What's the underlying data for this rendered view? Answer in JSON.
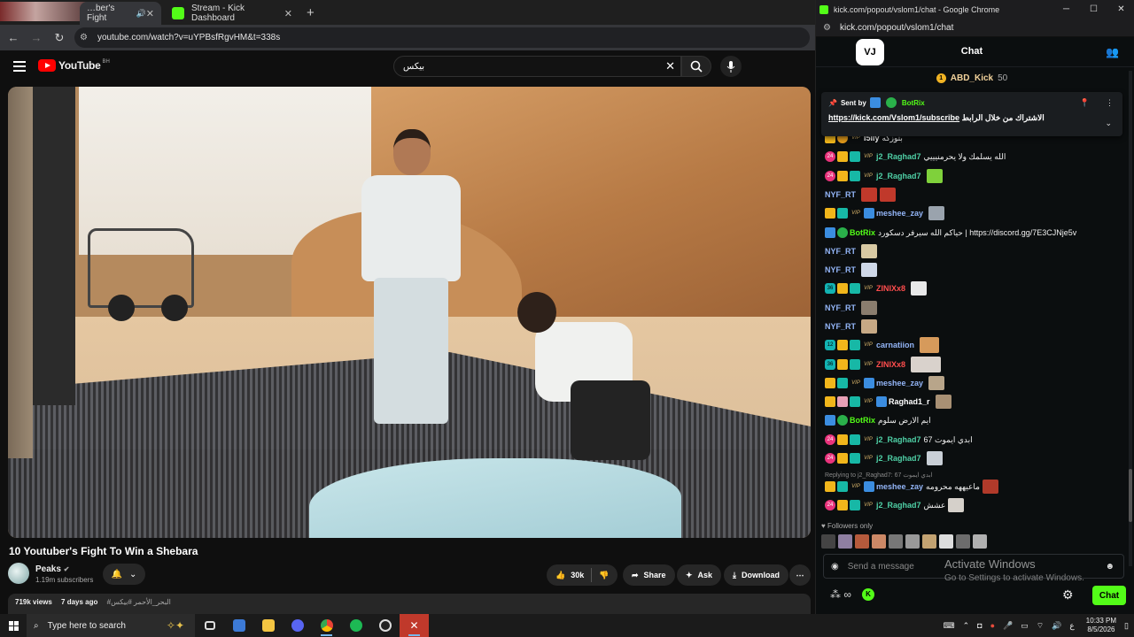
{
  "browser_left": {
    "tabs": [
      {
        "label": "…ber's Fight",
        "active": true
      },
      {
        "label": "Stream - Kick Dashboard",
        "active": false
      }
    ],
    "url": "youtube.com/watch?v=uYPBsfRgvHM&t=338s"
  },
  "youtube": {
    "logo_text": "YouTube",
    "region": "BH",
    "search_value": "بيكس",
    "video_title": "10 Youtuber's Fight To Win a Shebara",
    "channel_name": "Peaks",
    "subscribers": "1.19m subscribers",
    "likes": "30k",
    "share_label": "Share",
    "ask_label": "Ask",
    "download_label": "Download",
    "views": "719k views",
    "posted": "7 days ago",
    "tags": "#البحر_الأحمر #بيكس"
  },
  "kick": {
    "window_title": "kick.com/popout/vslom1/chat - Google Chrome",
    "url": "kick.com/popout/vslom1/chat",
    "logo": "VJ",
    "header_title": "Chat",
    "top_gifter": {
      "name": "ABD_Kick",
      "value": "50"
    },
    "pinned": {
      "sent_by_label": "Sent by",
      "sender": "BotRix",
      "link": "https://kick.com/Vslom1/subscribe",
      "text": "الاشتراك من خلال الرابط"
    },
    "messages": [
      {
        "user": "I5liy",
        "color": "#ffffff",
        "text": "بتوزكه",
        "emote": ""
      },
      {
        "user": "j2_Raghad7",
        "color": "#4fd0a6",
        "text": "الله يسلمك ولا يحرمنيييي",
        "emote": ""
      },
      {
        "user": "j2_Raghad7",
        "color": "#4fd0a6",
        "text": "",
        "emote": "#7fd13b"
      },
      {
        "user": "NYF_RT",
        "color": "#93b5f7",
        "text": "",
        "emote": "#c0392b"
      },
      {
        "user": "meshee_zay",
        "color": "#93b5f7",
        "text": "",
        "emote": "#9aa3ad"
      },
      {
        "user": "BotRix",
        "color": "#53fc18",
        "text": "حياكم الله سيرفر دسكورد | https://discord.gg/7E3CJNje5v",
        "emote": ""
      },
      {
        "user": "NYF_RT",
        "color": "#93b5f7",
        "text": "",
        "emote": "#d8c9a3"
      },
      {
        "user": "NYF_RT",
        "color": "#93b5f7",
        "text": "",
        "emote": "#cfd8e8"
      },
      {
        "user": "ZINIXx8",
        "color": "#ff4d4d",
        "text": "",
        "emote": "#e8e8e8"
      },
      {
        "user": "NYF_RT",
        "color": "#93b5f7",
        "text": "",
        "emote": "#8a7d6e"
      },
      {
        "user": "NYF_RT",
        "color": "#93b5f7",
        "text": "",
        "emote": "#c7a985"
      },
      {
        "user": "carnatiion",
        "color": "#93b5f7",
        "text": "",
        "emote": "#d69a5b"
      },
      {
        "user": "ZINIXx8",
        "color": "#ff4d4d",
        "text": "",
        "emote": "#d9d2cc"
      },
      {
        "user": "meshee_zay",
        "color": "#93b5f7",
        "text": "",
        "emote": "#b8a58a"
      },
      {
        "user": "Raghad1_r",
        "color": "#ffffff",
        "text": "",
        "emote": "#a89074"
      },
      {
        "user": "BotRix",
        "color": "#53fc18",
        "text": "ايم الارض سلوم",
        "emote": ""
      },
      {
        "user": "j2_Raghad7",
        "color": "#4fd0a6",
        "text": "67 ابدي ايموت",
        "emote": ""
      },
      {
        "user": "j2_Raghad7",
        "color": "#4fd0a6",
        "text": "",
        "emote": "#c9cfd6"
      },
      {
        "user": "meshee_zay",
        "color": "#93b5f7",
        "text": "ماعيههه محرومه",
        "emote": "#b13a2a"
      },
      {
        "user": "j2_Raghad7",
        "color": "#4fd0a6",
        "text": "عشش",
        "emote": "#d5d0ca"
      }
    ],
    "reply_context": "Replying to j2_Raghad7: 67 ابدي ايموت",
    "followers_only": "Followers only",
    "input_placeholder": "Send a message",
    "chat_button": "Chat",
    "activate_title": "Activate Windows",
    "activate_sub": "Go to Settings to activate Windows."
  },
  "taskbar": {
    "search_placeholder": "Type here to search",
    "lang": "ع",
    "time": "10:33 PM",
    "date": "8/5/2026"
  },
  "colors": {
    "kick_green": "#53fc18",
    "youtube_red": "#ff0000",
    "yt_bg": "#0f0f0f"
  }
}
